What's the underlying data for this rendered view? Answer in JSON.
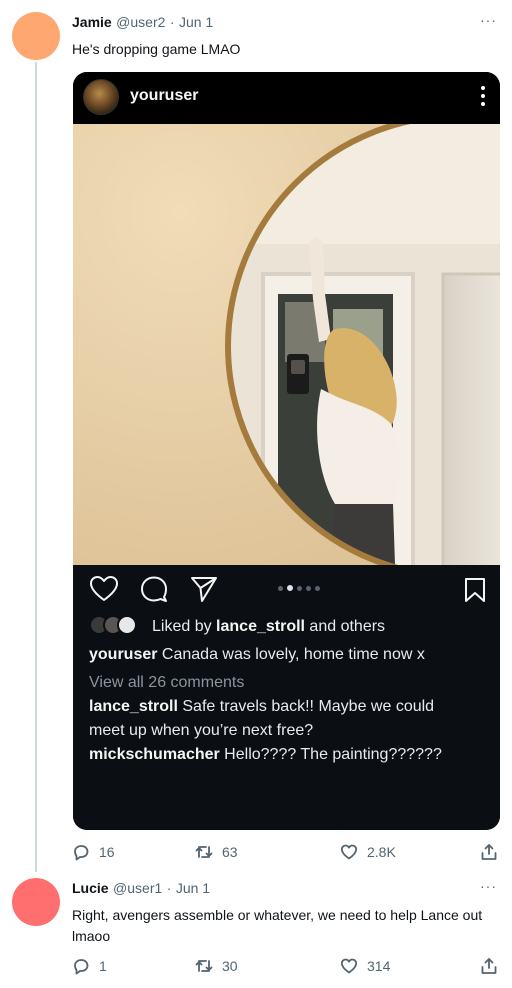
{
  "tweets": [
    {
      "name": "Jamie",
      "handle": "@user2",
      "sep": "·",
      "date": "Jun 1",
      "text": "He's dropping game LMAO",
      "more": "···",
      "replies": "16",
      "retweets": "63",
      "likes": "2.8K"
    },
    {
      "name": "Lucie",
      "handle": "@user1",
      "sep": "·",
      "date": "Jun 1",
      "text": "Right, avengers assemble or whatever, we need to help Lance out lmaoo",
      "more": "···",
      "replies": "1",
      "retweets": "30",
      "likes": "314"
    }
  ],
  "embed": {
    "username": "youruser",
    "liked_prefix": "Liked by ",
    "liked_user": "lance_stroll",
    "liked_suffix": " and others",
    "caption_user": "youruser",
    "caption_text": " Canada was lovely, home time now x",
    "view_comments": "View all 26 comments",
    "comments": [
      {
        "user": "lance_stroll",
        "text": " Safe travels back!! Maybe we could"
      },
      {
        "user": "",
        "text": "meet up when you’re next free?"
      },
      {
        "user": "mickschumacher",
        "text": " Hello???? The painting??????"
      }
    ]
  },
  "colors": {
    "avatar_jamie": "#ffa770",
    "avatar_lucie": "#ff6f6f",
    "thread_line": "#cfd9de",
    "muted_text": "#536471"
  }
}
